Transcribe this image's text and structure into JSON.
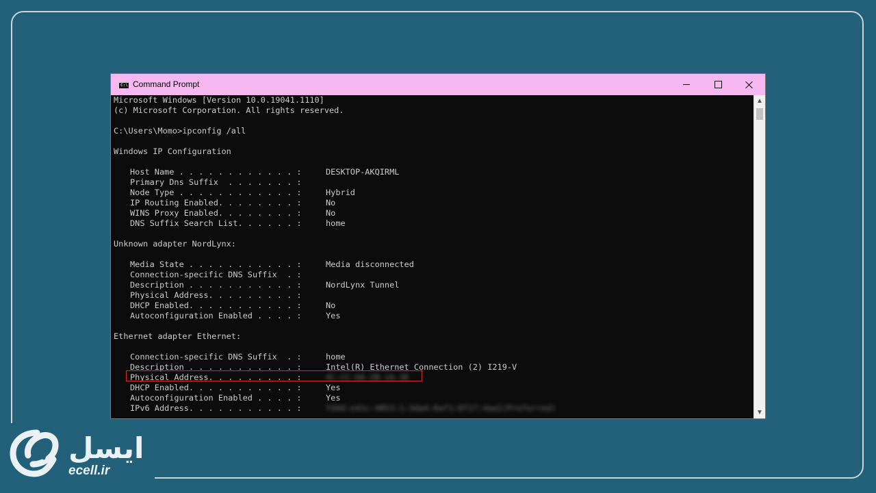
{
  "window": {
    "title": "Command Prompt",
    "icon": "cmd-icon",
    "icon_text": "C:\\",
    "titlebar_color": "#f7b8f1",
    "highlight_color": "#d92b2b"
  },
  "console": {
    "header_lines": [
      "Microsoft Windows [Version 10.0.19041.1110]",
      "(c) Microsoft Corporation. All rights reserved.",
      "C:\\Users\\Momo>ipconfig /all",
      "Windows IP Configuration"
    ],
    "ip_config": [
      {
        "label": "Host Name . . . . . . . . . . . . :",
        "value": "DESKTOP-AKQIRML"
      },
      {
        "label": "Primary Dns Suffix  . . . . . . . :",
        "value": ""
      },
      {
        "label": "Node Type . . . . . . . . . . . . :",
        "value": "Hybrid"
      },
      {
        "label": "IP Routing Enabled. . . . . . . . :",
        "value": "No"
      },
      {
        "label": "WINS Proxy Enabled. . . . . . . . :",
        "value": "No"
      },
      {
        "label": "DNS Suffix Search List. . . . . . :",
        "value": "home"
      }
    ],
    "adapter1_header": "Unknown adapter NordLynx:",
    "adapter1": [
      {
        "label": "Media State . . . . . . . . . . . :",
        "value": "Media disconnected"
      },
      {
        "label": "Connection-specific DNS Suffix  . :",
        "value": ""
      },
      {
        "label": "Description . . . . . . . . . . . :",
        "value": "NordLynx Tunnel"
      },
      {
        "label": "Physical Address. . . . . . . . . :",
        "value": ""
      },
      {
        "label": "DHCP Enabled. . . . . . . . . . . :",
        "value": "No"
      },
      {
        "label": "Autoconfiguration Enabled . . . . :",
        "value": "Yes"
      }
    ],
    "adapter2_header": "Ethernet adapter Ethernet:",
    "adapter2": [
      {
        "label": "Connection-specific DNS Suffix  . :",
        "value": "home"
      },
      {
        "label": "Description . . . . . . . . . . . :",
        "value": "Intel(R) Ethernet Connection (2) I219-V"
      },
      {
        "label": "Physical Address. . . . . . . . . :",
        "value": "4C-CC-6A-2B-1A-3E"
      },
      {
        "label": "DHCP Enabled. . . . . . . . . . . :",
        "value": "Yes"
      },
      {
        "label": "Autoconfiguration Enabled . . . . :",
        "value": "Yes"
      },
      {
        "label": "IPv6 Address. . . . . . . . . . . :",
        "value": "fd4d:e41c:4853:1:3da4:6af1:8f17:4aa1(Preferred)"
      }
    ]
  },
  "logo": {
    "persian": "ایسل",
    "url": "ecell.ir"
  }
}
